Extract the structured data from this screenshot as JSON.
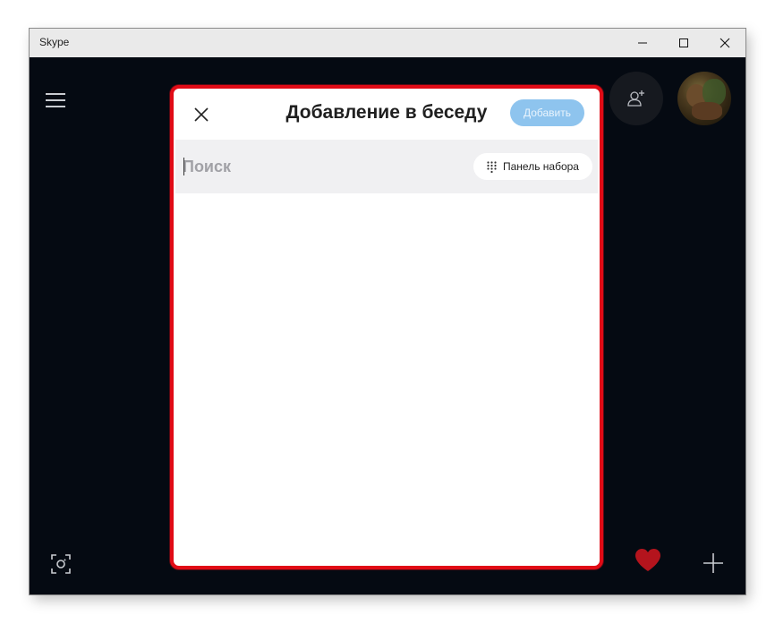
{
  "window": {
    "title": "Skype",
    "controls": {
      "minimize": "minimize-icon",
      "maximize": "maximize-icon",
      "close": "close-icon"
    }
  },
  "sidebar": {
    "menu_icon": "hamburger-icon",
    "camera_icon": "camera-icon"
  },
  "header": {
    "add_contact_icon": "add-contact-icon",
    "avatar": "user-avatar"
  },
  "footer": {
    "heart_icon": "heart-icon",
    "plus_icon": "plus-icon"
  },
  "dialog": {
    "title": "Добавление в беседу",
    "add_button": "Добавить",
    "close_icon": "close-icon",
    "search": {
      "value": "",
      "placeholder": "Поиск"
    },
    "dialpad_button": "Панель набора",
    "dialpad_icon": "dialpad-icon"
  },
  "colors": {
    "highlight_border": "#e10b16",
    "add_button_bg": "#8ec4ee",
    "app_bg": "#050a12",
    "heart": "#b4141d"
  }
}
